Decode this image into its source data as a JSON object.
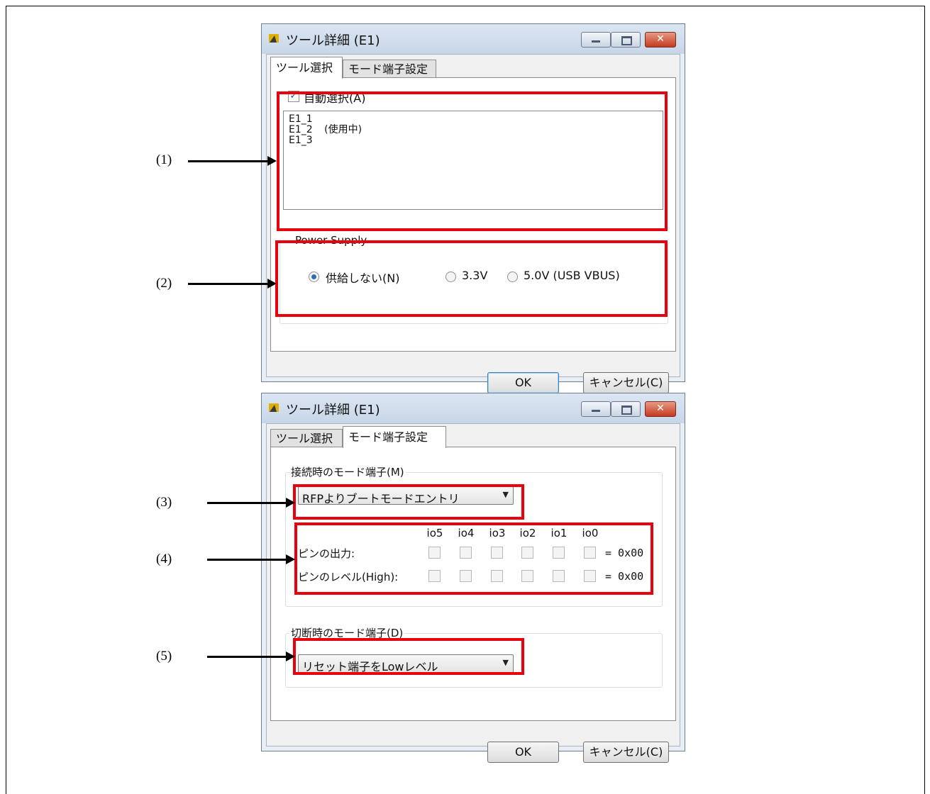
{
  "window1": {
    "title": "ツール詳細 (E1)",
    "tabs": [
      "ツール選択",
      "モード端子設定"
    ],
    "auto_select_label": "自動選択(A)",
    "auto_select_checked": true,
    "tools": [
      {
        "name": "E1_1",
        "status": ""
      },
      {
        "name": "E1_2",
        "status": "(使用中)"
      },
      {
        "name": "E1_3",
        "status": ""
      }
    ],
    "power_supply": {
      "title": "Power Supply",
      "options": [
        "供給しない(N)",
        "3.3V",
        "5.0V (USB VBUS)"
      ],
      "selected": "供給しない(N)"
    },
    "ok_label": "OK",
    "cancel_label": "キャンセル(C)"
  },
  "window2": {
    "title": "ツール詳細 (E1)",
    "tabs": [
      "ツール選択",
      "モード端子設定"
    ],
    "connect_group_title": "接続時のモード端子(M)",
    "connect_mode_value": "RFPよりブートモードエントリ",
    "io_columns": [
      "io5",
      "io4",
      "io3",
      "io2",
      "io1",
      "io0"
    ],
    "pin_output_label": "ピンの出力:",
    "pin_output_value": "= 0x00",
    "pin_level_label": "ピンのレベル(High):",
    "pin_level_value": "= 0x00",
    "disconnect_group_title": "切断時のモード端子(D)",
    "disconnect_mode_value": "リセット端子をLowレベル",
    "ok_label": "OK",
    "cancel_label": "キャンセル(C)"
  },
  "callouts": [
    "(1)",
    "(2)",
    "(3)",
    "(4)",
    "(5)"
  ],
  "colors": {
    "highlight": "#e8000d",
    "window_frame": "#c7d6e8"
  }
}
